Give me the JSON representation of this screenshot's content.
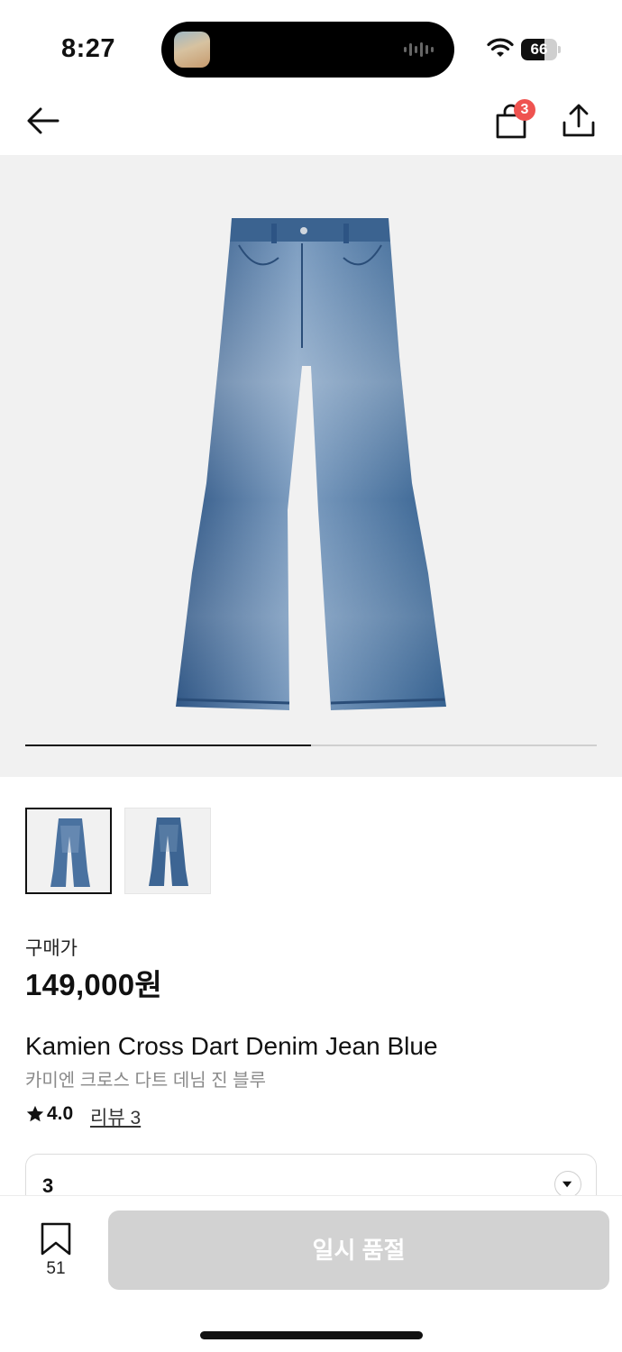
{
  "status_bar": {
    "time": "8:27",
    "battery": "66",
    "battery_level": 0.66,
    "wifi_icon": "wifi-icon"
  },
  "nav": {
    "back_icon": "arrow-left-icon",
    "cart_icon": "shopping-bag-icon",
    "cart_badge": "3",
    "share_icon": "share-icon"
  },
  "gallery": {
    "image_count": 2,
    "current_index": 1,
    "progress_fraction": 0.5
  },
  "product": {
    "price_label": "구매가",
    "price": "149,000원",
    "name_en": "Kamien Cross Dart Denim Jean Blue",
    "name_kr": "카미엔 크로스 다트 데님 진 블루",
    "rating": "4.0",
    "review_link": "리뷰 3"
  },
  "option_select": {
    "value": "3",
    "arrow_icon": "caret-down-icon"
  },
  "bottom_bar": {
    "bookmark_icon": "bookmark-icon",
    "bookmark_count": "51",
    "action_label": "일시 품절"
  },
  "colors": {
    "badge": "#ef5350",
    "hero_bg": "#f1f1f1",
    "disabled_button": "#d2d2d2",
    "denim": "#3f6796"
  }
}
